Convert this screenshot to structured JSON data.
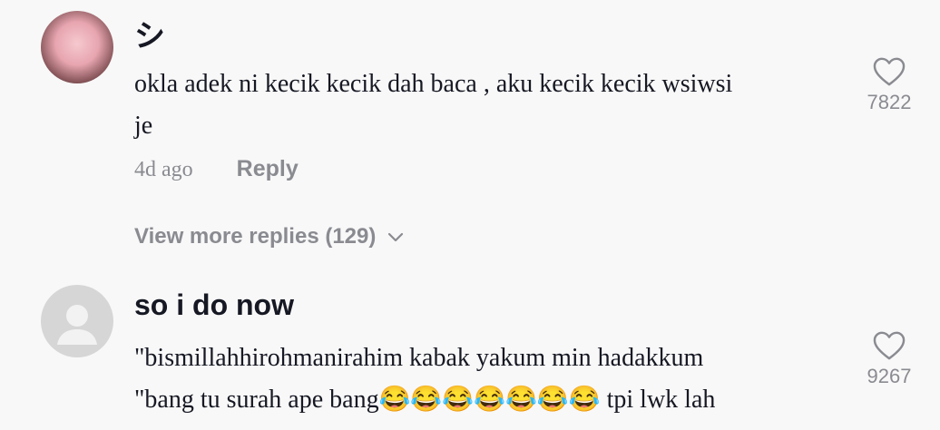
{
  "comments": [
    {
      "username": "シ",
      "text_line1": "okla adek ni kecik kecik dah baca , aku kecik kecik wsiwsi",
      "text_line2": "je",
      "time": "4d ago",
      "reply_label": "Reply",
      "likes": "7822",
      "view_more_label": "View more replies (129)"
    },
    {
      "username": "so i do now",
      "text_line1": "\"bismillahhirohmanirahim kabak yakum min hadakkum",
      "text_line2": "\"bang tu surah ape bang😂😂😂😂😂😂😂 tpi lwk lah",
      "likes": "9267"
    }
  ],
  "icons": {
    "like": "heart-outline-icon",
    "expand": "chevron-down-icon"
  },
  "colors": {
    "background": "#f8f8f8",
    "primary_text": "#161823",
    "secondary_text": "#8a8b91"
  }
}
